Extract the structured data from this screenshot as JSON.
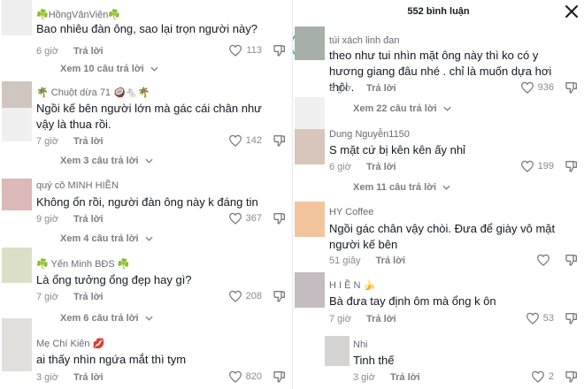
{
  "header": {
    "title": "552 bình luận"
  },
  "left_comments": [
    {
      "username": "☘️HồngVânViên☘️",
      "text": "Bao nhiêu đàn ông, sao lại trọn người này?",
      "time": "6 giờ",
      "reply_label": "Trả lời",
      "likes": "113",
      "view_replies": "Xem 10 câu trả lời",
      "avatar_color": "#b8b6bd"
    },
    {
      "username": "🌴 Chuột dừa 71 🥥🐁🌴",
      "text": "Ngồi kế bên người lớn mà gác cái chân như vậy là thua rồi.",
      "time": "7 giờ",
      "reply_label": "Trả lời",
      "likes": "142",
      "view_replies": "Xem 3 câu trả lời",
      "avatar_color": "#cfc6bf"
    },
    {
      "username": "quý cô MINH HIỀN",
      "text": "Không ổn rồi, người đàn ông này k đáng tin",
      "time": "9 giờ",
      "reply_label": "Trả lời",
      "likes": "367",
      "view_replies": "Xem 4 câu trả lời",
      "avatar_color": "#dcb8b8"
    },
    {
      "username": "☘️ Yến Minh BĐS ☘️",
      "text": "Là ổng tưởng ổng đẹp hay gì?",
      "time": "7 giờ",
      "reply_label": "Trả lời",
      "likes": "208",
      "view_replies": "Xem 6 câu trả lời",
      "avatar_color": "#dcdfc8"
    },
    {
      "username": "Mẹ Chí Kiên 💋",
      "text": "ai thấy nhìn ngứa mắt thì tym",
      "time": "3 giờ",
      "reply_label": "Trả lời",
      "likes": "820",
      "view_replies": "",
      "avatar_color": "#e2e0dd"
    }
  ],
  "right_comments": [
    {
      "username": "túi xách linh đan",
      "text": "theo như tui nhìn mặt ông này thì ko có y hương giang đâu nhé . chỉ là muốn dựa hơi thôi .",
      "time": "8 giờ",
      "reply_label": "Trả lời",
      "likes": "936",
      "view_replies": "Xem 22 câu trả lời",
      "avatar_color": "#a7b0a8"
    },
    {
      "username": "Dung Nguyễn1150",
      "text": "S mặt cứ bị kên kên ấy nhỉ",
      "time": "6 giờ",
      "reply_label": "Trả lời",
      "likes": "199",
      "view_replies": "Xem 11 câu trả lời",
      "avatar_color": "#d8c6bc"
    },
    {
      "username": "HY Coffee",
      "text": "Ngồi gác chân vậy chòi. Đưa để giày vô mặt người kế bên",
      "time": "51 giây",
      "reply_label": "Trả lời",
      "likes": "",
      "view_replies": "",
      "avatar_color": "#f2c49c"
    },
    {
      "username": "H I Ề N 🍌",
      "text": "Bà đưa tay định ôm mà ổng k ôn",
      "time": "7 giờ",
      "reply_label": "Trả lời",
      "likes": "53",
      "view_replies": "",
      "avatar_color": "#c4bcc0"
    },
    {
      "username": "Nhi",
      "text": "Tinh thế",
      "time": "3 giờ",
      "reply_label": "Trả lời",
      "likes": "2",
      "view_replies": "",
      "avatar_color": "#d6d4d3"
    }
  ],
  "icons": {
    "like": "heart-outline-icon",
    "dislike": "thumbs-down-icon",
    "expand": "chevron-down-icon",
    "close": "close-icon"
  }
}
